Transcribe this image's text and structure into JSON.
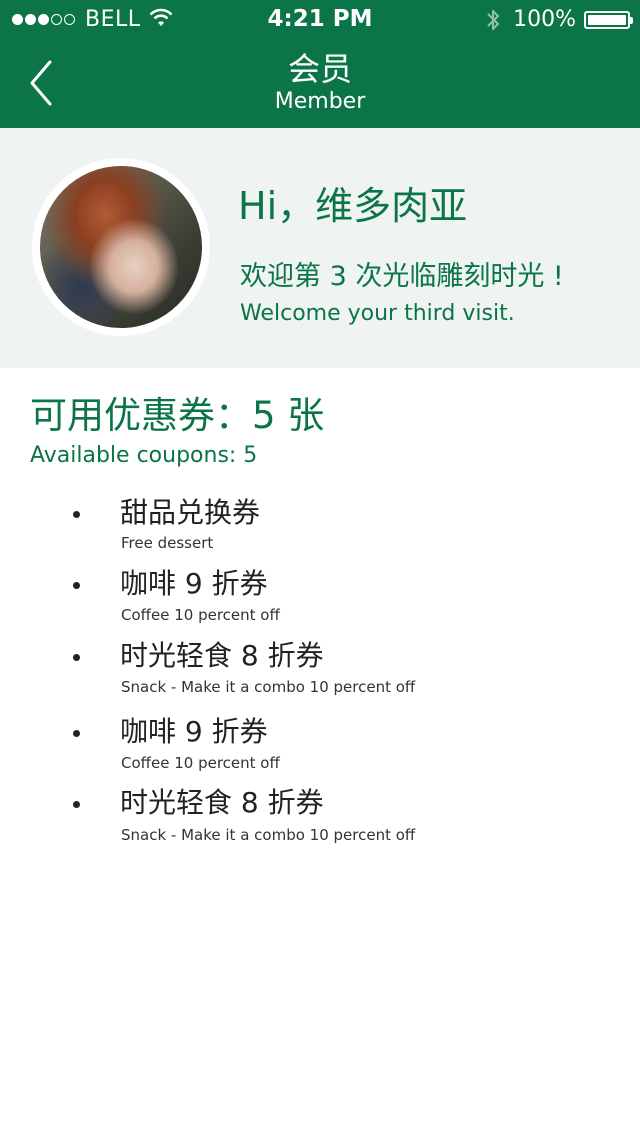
{
  "status_bar": {
    "carrier": "BELL",
    "time": "4:21 PM",
    "battery": "100%",
    "signal_dots_filled": 3,
    "signal_dots_total": 5
  },
  "nav": {
    "title": "会员",
    "subtitle": "Member"
  },
  "profile": {
    "greeting": "Hi，维多肉亚",
    "welcome_cn": "欢迎第 3 次光临雕刻时光 !",
    "welcome_en": "Welcome your third visit."
  },
  "coupons": {
    "title": "可用优惠券：5 张",
    "subtitle": "Available coupons: 5",
    "items": [
      {
        "cn": "甜品兑换券",
        "en": "Free dessert"
      },
      {
        "cn": "咖啡 9 折券",
        "en": "Coffee 10 percent off"
      },
      {
        "cn": "时光轻食 8 折券",
        "en": "Snack - Make it a combo 10 percent off"
      },
      {
        "cn": "咖啡 9 折券",
        "en": "Coffee 10 percent off"
      },
      {
        "cn": "时光轻食 8 折券",
        "en": "Snack - Make it a combo 10 percent off"
      }
    ]
  },
  "colors": {
    "brand_green": "#0b7548",
    "profile_background": "#eff3f1"
  }
}
